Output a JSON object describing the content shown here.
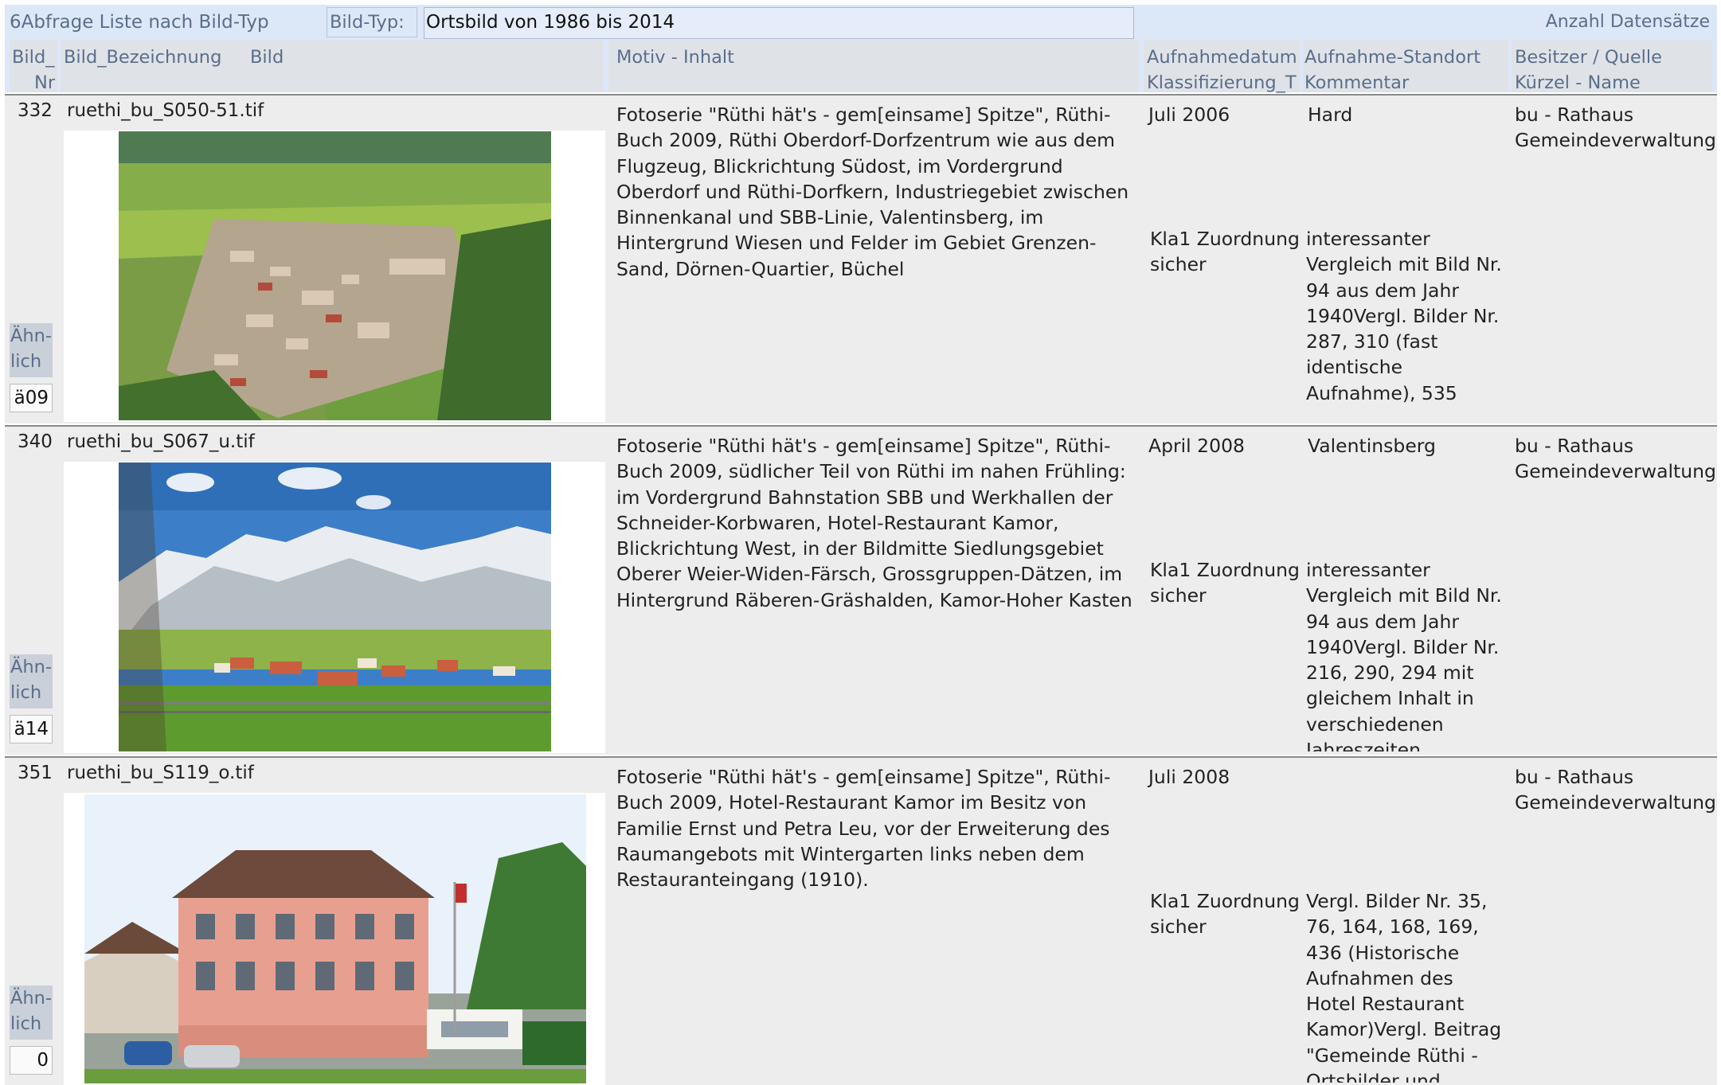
{
  "report": {
    "title": "6Abfrage Liste nach Bild-Typ",
    "bildtyp_label": "Bild-Typ:",
    "bildtyp_value": "Ortsbild von 1986 bis 2014",
    "record_count_label": "Anzahl Datensätze"
  },
  "columns": {
    "bild_nr_1": "Bild_",
    "bild_nr_2": "Nr",
    "bezeichnung": "Bild_Bezeichnung",
    "bild": "Bild",
    "motiv": "Motiv - Inhalt",
    "datum_1": "Aufnahmedatum",
    "datum_2": "Klassifizierung_T",
    "standort_1": "Aufnahme-Standort",
    "standort_2": "Kommentar",
    "besitzer_1": "Besitzer / Quelle",
    "besitzer_2": "Kürzel - Name"
  },
  "records": [
    {
      "nr": "332",
      "bezeichnung": "ruethi_bu_S050-51.tif",
      "motiv": "Fotoserie \"Rüthi hät's - gem[einsame] Spitze\", Rüthi-Buch 2009, Rüthi Oberdorf-Dorfzentrum wie aus dem Flugzeug, Blickrichtung Südost, im Vordergrund Oberdorf und Rüthi-Dorfkern, Industriegebiet zwischen Binnenkanal und SBB-Linie, Valentinsberg,  im Hintergrund Wiesen und Felder im Gebiet Grenzen-Sand, Dörnen-Quartier, Büchel",
      "datum": "Juli 2006",
      "klassifizierung": "Kla1 Zuordnung sicher",
      "standort": "Hard",
      "kommentar": "interessanter Vergleich mit Bild Nr. 94 aus dem Jahr 1940Vergl. Bilder Nr. 287, 310 (fast identische Aufnahme), 535",
      "besitzer_kuerzel": "bu - Rathaus",
      "besitzer_name": "Gemeindeverwaltung",
      "aehnlich_label": "Ähn-lich",
      "aehnlich_value": "ä09",
      "photo_icon": "village-aerial-photo"
    },
    {
      "nr": "340",
      "bezeichnung": "ruethi_bu_S067_u.tif",
      "motiv": "Fotoserie \"Rüthi hät's - gem[einsame] Spitze\", Rüthi-Buch 2009, südlicher Teil von Rüthi im nahen Frühling: im Vordergrund Bahnstation SBB und Werkhallen der Schneider-Korbwaren, Hotel-Restaurant Kamor, Blickrichtung West,  in der Bildmitte Siedlungsgebiet Oberer Weier-Widen-Färsch, Grossgruppen-Dätzen, im Hintergrund Räberen-Gräshalden, Kamor-Hoher Kasten",
      "datum": "April 2008",
      "klassifizierung": "Kla1 Zuordnung sicher",
      "standort": "Valentinsberg",
      "kommentar": "interessanter Vergleich mit Bild Nr. 94 aus dem Jahr 1940Vergl. Bilder Nr. 216, 290, 294 mit gleichem Inhalt in verschiedenen Jahreszeiten",
      "besitzer_kuerzel": "bu - Rathaus",
      "besitzer_name": "Gemeindeverwaltung",
      "aehnlich_label": "Ähn-lich",
      "aehnlich_value": "ä14",
      "photo_icon": "snowy-mountain-photo"
    },
    {
      "nr": "351",
      "bezeichnung": "ruethi_bu_S119_o.tif",
      "motiv": "Fotoserie \"Rüthi hät's - gem[einsame] Spitze\", Rüthi-Buch 2009, Hotel-Restaurant Kamor im Besitz von Familie Ernst und Petra Leu, vor der Erweiterung des Raumangebots mit Wintergarten links neben dem Restauranteingang (1910).",
      "datum": "Juli 2008",
      "klassifizierung": "Kla1 Zuordnung sicher",
      "standort": "",
      "kommentar": "Vergl. Bilder Nr. 35, 76, 164, 168, 169, 436 (Historische Aufnahmen des Hotel Restaurant Kamor)Vergl. Beitrag \"Gemeinde Rüthi - Ortsbilder und",
      "besitzer_kuerzel": "bu - Rathaus",
      "besitzer_name": "Gemeindeverwaltung",
      "aehnlich_label": "Ähn-lich",
      "aehnlich_value": "0",
      "photo_icon": "hotel-building-photo"
    }
  ]
}
